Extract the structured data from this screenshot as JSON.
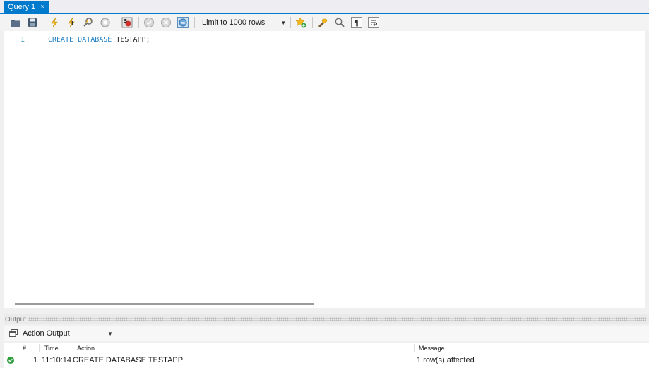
{
  "tabs": [
    {
      "label": "Query 1",
      "close": "×",
      "active": true
    }
  ],
  "toolbar": {
    "buttons": [
      "open-folder-icon",
      "save-icon",
      "execute-icon",
      "execute-current-icon",
      "explain-icon",
      "stop-icon",
      "toggle-continue-on-error-icon",
      "commit-icon",
      "rollback-icon",
      "autocommit-icon",
      "add-snippet-icon",
      "beautify-icon",
      "find-icon",
      "invisible-chars-icon",
      "word-wrap-icon"
    ],
    "limit_select": {
      "value": "Limit to 1000 rows"
    }
  },
  "editor": {
    "lines": [
      {
        "number": "1",
        "tokens": [
          {
            "text": "CREATE",
            "kind": "keyword"
          },
          {
            "text": " ",
            "kind": "space"
          },
          {
            "text": "DATABASE",
            "kind": "keyword"
          },
          {
            "text": " ",
            "kind": "space"
          },
          {
            "text": "TESTAPP;",
            "kind": "identifier"
          }
        ]
      }
    ]
  },
  "output": {
    "title": "Output",
    "selector": {
      "value": "Action Output"
    },
    "columns": {
      "index": "#",
      "time": "Time",
      "action": "Action",
      "message": "Message"
    },
    "rows": [
      {
        "status": "success",
        "index": "1",
        "time": "11:10:14",
        "action": "CREATE DATABASE TESTAPP",
        "message": "1 row(s) affected"
      }
    ]
  },
  "colors": {
    "accent": "#007acc",
    "keyword": "#1e7ec4",
    "line_number": "#2b91af",
    "success": "#2e9e3e"
  }
}
